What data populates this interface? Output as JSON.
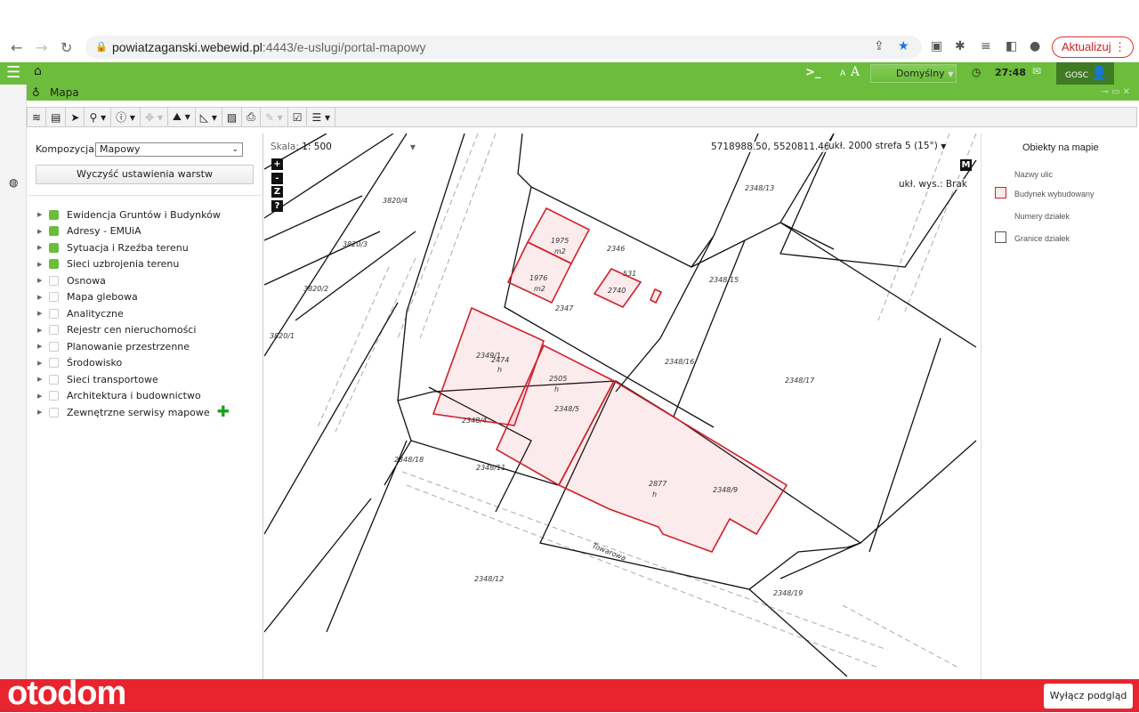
{
  "browser": {
    "url_host": "powiatzaganski.webewid.pl",
    "url_rest": ":4443/e-uslugi/portal-mapowy",
    "update_label": "Aktualizuj"
  },
  "topbar": {
    "font_small": "A",
    "font_large": "A",
    "theme": "Domyślny",
    "timer": "27:48",
    "user": "GOSC"
  },
  "panel": {
    "title": "Mapa"
  },
  "sidebar": {
    "composition_label": "Kompozycja:",
    "composition_value": "Mapowy",
    "clear_button": "Wyczyść ustawienia warstw",
    "layers": [
      {
        "label": "Ewidencja Gruntów i Budynków",
        "checked": true
      },
      {
        "label": "Adresy - EMUiA",
        "checked": true
      },
      {
        "label": "Sytuacja i Rzeźba terenu",
        "checked": true
      },
      {
        "label": "Sieci uzbrojenia terenu",
        "checked": true
      },
      {
        "label": "Osnowa",
        "checked": false
      },
      {
        "label": "Mapa glebowa",
        "checked": false
      },
      {
        "label": "Analityczne",
        "checked": false
      },
      {
        "label": "Rejestr cen nieruchomości",
        "checked": false
      },
      {
        "label": "Planowanie przestrzenne",
        "checked": false
      },
      {
        "label": "Środowisko",
        "checked": false
      },
      {
        "label": "Sieci transportowe",
        "checked": false
      },
      {
        "label": "Architektura i budownictwo",
        "checked": false
      },
      {
        "label": "Zewnętrzne serwisy mapowe",
        "checked": false
      }
    ]
  },
  "map": {
    "scale_label": "Skala:",
    "scale_value": "1: 500",
    "coords": "5718988.50, 5520811.46",
    "crs": "ukł. 2000 strefa 5 (15°)",
    "height_system": "ukł. wys.: Brak",
    "m_button": "M",
    "zoom_in": "+",
    "zoom_out": "-",
    "zoom_z": "Z",
    "help": "?",
    "labels": [
      "3820/4",
      "3820/3",
      "3820/2",
      "3820/1",
      "2348/13",
      "2346",
      "2347",
      "2348/15",
      "2348/16",
      "2348/17",
      "2349/1",
      "2474",
      "h",
      "2348/4",
      "2505",
      "h",
      "2348/5",
      "2348/18",
      "2348/11",
      "2877",
      "h",
      "2348/9",
      "2348/12",
      "2348/19",
      "Towarowa",
      "1975",
      "m2",
      "1976",
      "m2",
      "2740",
      "531"
    ]
  },
  "legend": {
    "title": "Obiekty na mapie",
    "items": [
      "Nazwy ulic",
      "Budynek wybudowany",
      "Numery działek",
      "Granice działek"
    ]
  },
  "footer": {
    "logo": "otodom",
    "preview_off": "Wyłącz podgląd"
  },
  "colors": {
    "green": "#6bbd3b",
    "building": "#d0202a",
    "brand_red": "#e8242f"
  }
}
